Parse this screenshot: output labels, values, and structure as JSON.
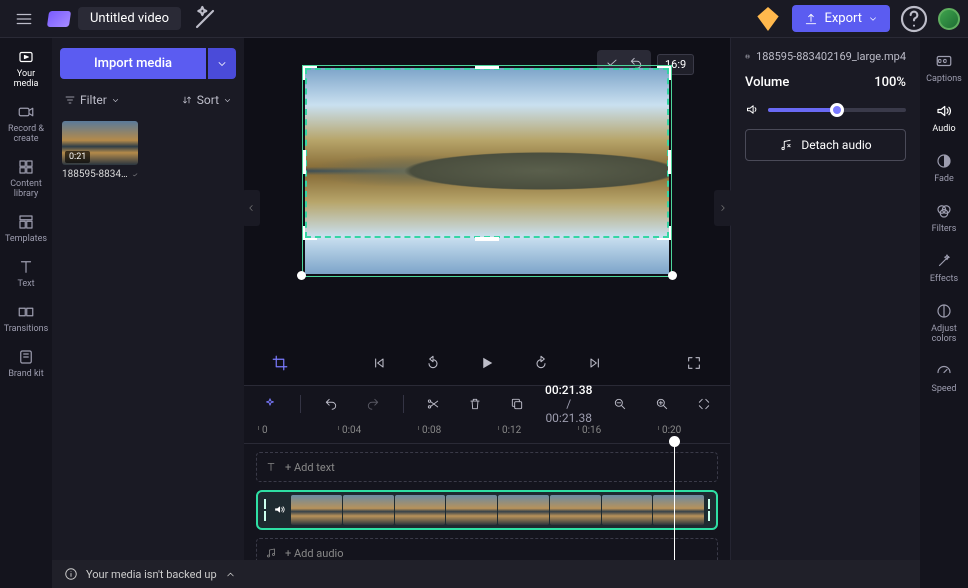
{
  "header": {
    "title": "Untitled video",
    "export_label": "Export"
  },
  "left_rail": [
    {
      "label": "Your media"
    },
    {
      "label": "Record & create"
    },
    {
      "label": "Content library"
    },
    {
      "label": "Templates"
    },
    {
      "label": "Text"
    },
    {
      "label": "Transitions"
    },
    {
      "label": "Brand kit"
    }
  ],
  "media_panel": {
    "import_label": "Import media",
    "filter_label": "Filter",
    "sort_label": "Sort",
    "items": [
      {
        "duration": "0:21",
        "name": "188595-8834…"
      }
    ]
  },
  "preview": {
    "aspect": "16:9"
  },
  "timeline": {
    "current": "00:21.38",
    "total": "00:21.38",
    "ticks": [
      "0",
      "0:04",
      "0:08",
      "0:12",
      "0:16",
      "0:20"
    ],
    "add_text": "+ Add text",
    "add_audio": "+ Add audio"
  },
  "right_panel": {
    "filename": "188595-883402169_large.mp4",
    "volume_label": "Volume",
    "volume_value": "100%",
    "detach_label": "Detach audio"
  },
  "right_rail": [
    {
      "label": "Captions"
    },
    {
      "label": "Audio"
    },
    {
      "label": "Fade"
    },
    {
      "label": "Filters"
    },
    {
      "label": "Effects"
    },
    {
      "label": "Adjust colors"
    },
    {
      "label": "Speed"
    }
  ],
  "footer": {
    "message": "Your media isn't backed up"
  }
}
